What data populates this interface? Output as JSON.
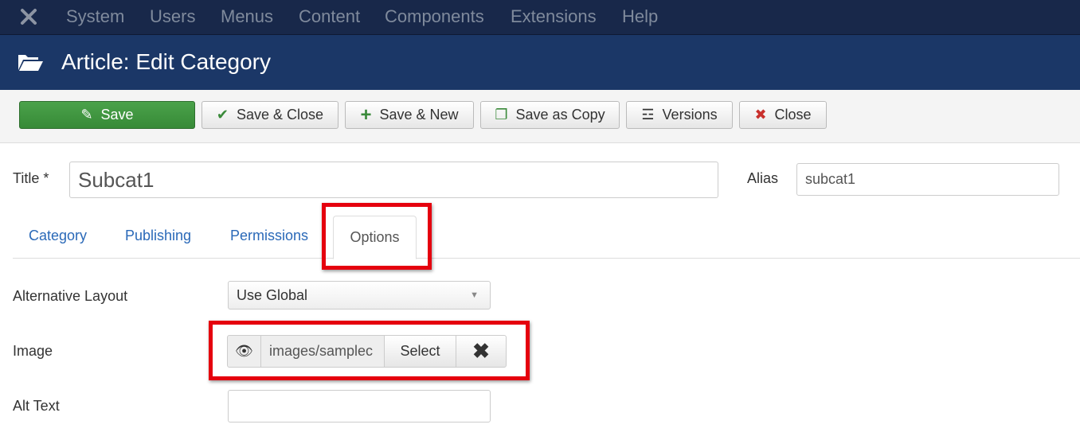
{
  "nav": {
    "items": [
      "System",
      "Users",
      "Menus",
      "Content",
      "Components",
      "Extensions",
      "Help"
    ]
  },
  "header": {
    "title": "Article: Edit Category"
  },
  "toolbar": {
    "save": "Save",
    "save_close": "Save & Close",
    "save_new": "Save & New",
    "save_copy": "Save as Copy",
    "versions": "Versions",
    "close": "Close"
  },
  "form": {
    "title_label": "Title *",
    "title_value": "Subcat1",
    "alias_label": "Alias",
    "alias_value": "subcat1"
  },
  "tabs": [
    "Category",
    "Publishing",
    "Permissions",
    "Options"
  ],
  "options": {
    "alt_layout_label": "Alternative Layout",
    "alt_layout_value": "Use Global",
    "image_label": "Image",
    "image_value": "images/samplec",
    "select_label": "Select",
    "alt_text_label": "Alt Text",
    "alt_text_value": ""
  },
  "colors": {
    "highlight": "#e5000e",
    "header": "#1b3767",
    "save": "#43a047"
  }
}
